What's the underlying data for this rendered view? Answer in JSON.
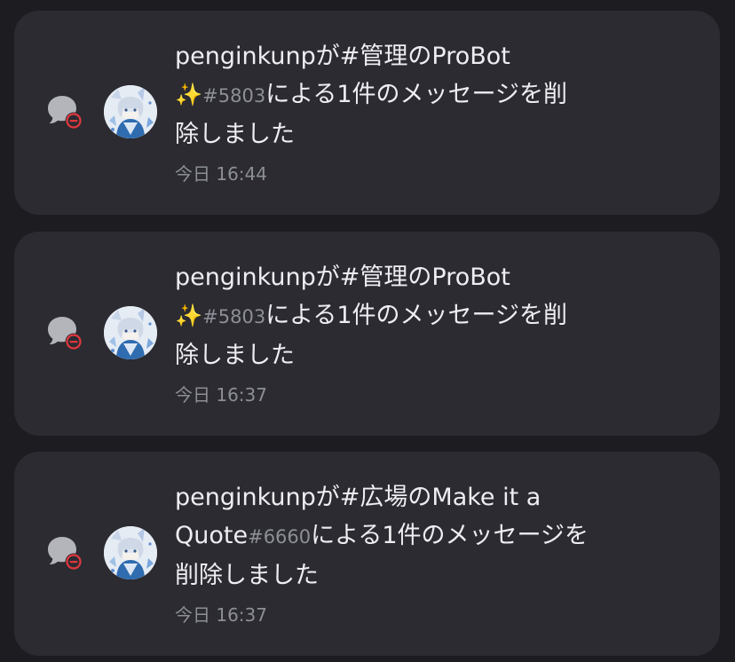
{
  "notifications": [
    {
      "user": "penginkunp",
      "ga": "が",
      "channel": "#管理",
      "no": "の",
      "bot_name": "ProBot",
      "bot_emoji": "✨",
      "discriminator": "#5803",
      "suffix_a": "による1件のメッセージを削",
      "suffix_b": "除しました",
      "time": "今日 16:44"
    },
    {
      "user": "penginkunp",
      "ga": "が",
      "channel": "#管理",
      "no": "の",
      "bot_name": "ProBot",
      "bot_emoji": "✨",
      "discriminator": "#5803",
      "suffix_a": "による1件のメッセージを削",
      "suffix_b": "除しました",
      "time": "今日 16:37"
    },
    {
      "user": "penginkunp",
      "ga": "が",
      "channel": "#広場",
      "no": "の",
      "bot_name_a": "Make it a",
      "bot_name_b": "Quote",
      "discriminator": "#6660",
      "suffix_a": "による1件のメッセージを",
      "suffix_b": "削除しました",
      "time": "今日 16:37"
    }
  ],
  "icons": {
    "type_icon": "message-delete-icon",
    "avatar": "bot-avatar"
  },
  "colors": {
    "background": "#1c1c21",
    "card": "#2b2b31",
    "text": "#eeeef2",
    "muted": "#8d8f96",
    "delete_badge": "#e0383e"
  }
}
